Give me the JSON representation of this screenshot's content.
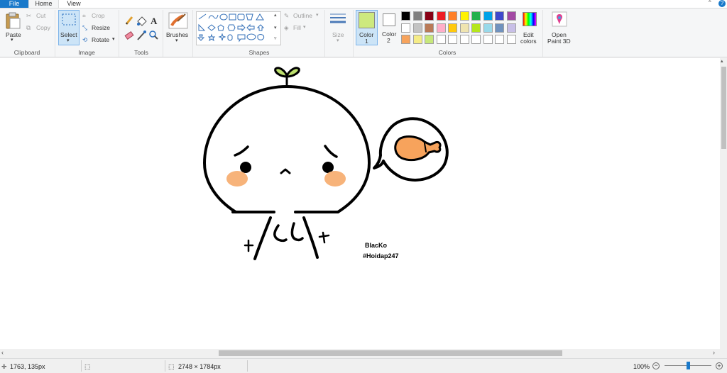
{
  "tabs": {
    "file": "File",
    "home": "Home",
    "view": "View"
  },
  "clipboard": {
    "paste": "Paste",
    "cut": "Cut",
    "copy": "Copy",
    "group": "Clipboard"
  },
  "image": {
    "select": "Select",
    "crop": "Crop",
    "resize": "Resize",
    "rotate": "Rotate",
    "group": "Image"
  },
  "tools": {
    "group": "Tools"
  },
  "brushes": {
    "label": "Brushes"
  },
  "shapes": {
    "outline": "Outline",
    "fill": "Fill",
    "group": "Shapes"
  },
  "size": {
    "label": "Size"
  },
  "color1": {
    "label": "Color",
    "num": "1",
    "value": "#cde97e"
  },
  "color2": {
    "label": "Color",
    "num": "2",
    "value": "#ffffff"
  },
  "colors": {
    "group": "Colors",
    "row1": [
      "#000000",
      "#7f7f7f",
      "#880015",
      "#ed1c24",
      "#ff7f27",
      "#fff200",
      "#22b14c",
      "#00a2e8",
      "#3f48cc",
      "#a349a4"
    ],
    "row2": [
      "#ffffff",
      "#c3c3c3",
      "#b97a57",
      "#ffaec9",
      "#ffc90e",
      "#efe4b0",
      "#b5e61d",
      "#99d9ea",
      "#7092be",
      "#c8bfe7"
    ],
    "row3": [
      "#f7a35c",
      "#f5ec87",
      "#c7e87b",
      "#ffffff",
      "#ffffff",
      "#ffffff",
      "#ffffff",
      "#ffffff",
      "#ffffff",
      "#ffffff"
    ]
  },
  "edit_colors": {
    "line1": "Edit",
    "line2": "colors"
  },
  "paint3d": {
    "line1": "Open",
    "line2": "Paint 3D"
  },
  "drawing": {
    "signature1": "BlacKo",
    "signature2": "#Hoidap247"
  },
  "status": {
    "cursor": "1763, 135px",
    "dimensions": "2748 × 1784px",
    "zoom": "100%"
  }
}
